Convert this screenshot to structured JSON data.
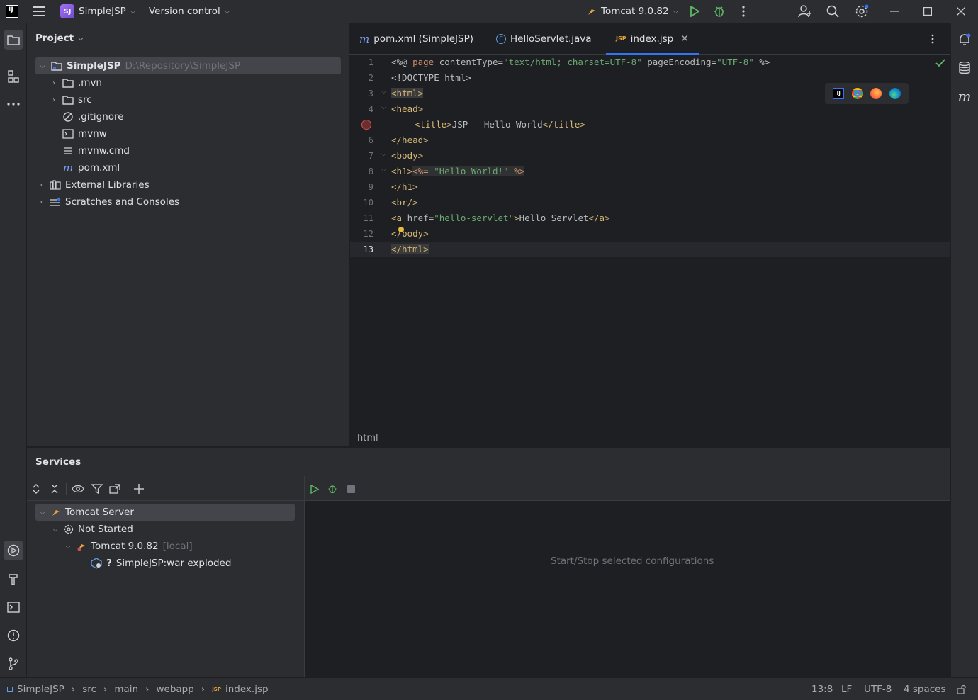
{
  "titlebar": {
    "logo_text": "IJ",
    "project_badge": "SJ",
    "project_name": "SimpleJSP",
    "vcs_label": "Version control",
    "run_config": "Tomcat 9.0.82"
  },
  "project_panel": {
    "title": "Project",
    "tree": [
      {
        "label": "SimpleJSP",
        "path": "D:\\Repository\\SimpleJSP"
      },
      {
        "label": ".mvn"
      },
      {
        "label": "src"
      },
      {
        "label": ".gitignore"
      },
      {
        "label": "mvnw"
      },
      {
        "label": "mvnw.cmd"
      },
      {
        "label": "pom.xml"
      },
      {
        "label": "External Libraries"
      },
      {
        "label": "Scratches and Consoles"
      }
    ]
  },
  "editor": {
    "tabs": [
      {
        "label": "pom.xml (SimpleJSP)",
        "icon": "m"
      },
      {
        "label": "HelloServlet.java",
        "icon": "C"
      },
      {
        "label": "index.jsp",
        "icon": "JSP"
      }
    ],
    "line_numbers": [
      "1",
      "2",
      "3",
      "4",
      "5",
      "6",
      "7",
      "8",
      "9",
      "10",
      "11",
      "12",
      "13"
    ],
    "code": {
      "l1_a": "<%@ ",
      "l1_b": "page ",
      "l1_c": "contentType=",
      "l1_d": "\"text/html; charset=UTF-8\"",
      "l1_e": " pageEncoding=",
      "l1_f": "\"UTF-8\"",
      "l1_g": " %>",
      "l2": "<!DOCTYPE html>",
      "l3": "<html>",
      "l4": "<head>",
      "l5_a": "<title>",
      "l5_b": "JSP - Hello World",
      "l5_c": "</title>",
      "l6": "</head>",
      "l7": "<body>",
      "l8_a": "<h1>",
      "l8_b": "<%= ",
      "l8_c": "\"Hello World!\"",
      "l8_d": " %>",
      "l9": "</h1>",
      "l10": "<br/>",
      "l11_a": "<a ",
      "l11_b": "href=",
      "l11_c": "\"",
      "l11_d": "hello-servlet",
      "l11_e": "\"",
      "l11_f": ">",
      "l11_g": "Hello Servlet",
      "l11_h": "</a>",
      "l12": "</body>",
      "l13": "</html>"
    },
    "breadcrumb": "html"
  },
  "services": {
    "title": "Services",
    "tree": [
      {
        "label": "Tomcat Server"
      },
      {
        "label": "Not Started"
      },
      {
        "label": "Tomcat 9.0.82",
        "suffix": "[local]"
      },
      {
        "label": "SimpleJSP:war exploded",
        "prefix": "?"
      }
    ],
    "empty_text": "Start/Stop selected configurations"
  },
  "statusbar": {
    "path": [
      "SimpleJSP",
      "src",
      "main",
      "webapp",
      "index.jsp"
    ],
    "position": "13:8",
    "line_sep": "LF",
    "encoding": "UTF-8",
    "indent": "4 spaces"
  },
  "colors": {
    "accent": "#3574f0",
    "run_green": "#5fb865",
    "breakpoint": "#c75450"
  }
}
